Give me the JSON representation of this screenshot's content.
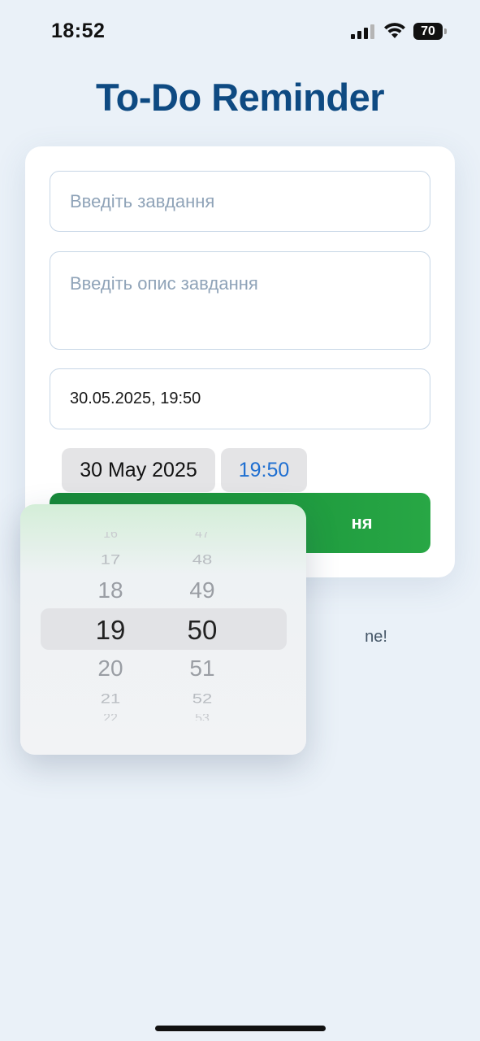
{
  "status_bar": {
    "time": "18:52",
    "battery": "70",
    "icons": [
      "signal-icon",
      "wifi-icon",
      "battery-icon"
    ]
  },
  "title": "To-Do Reminder",
  "form": {
    "task_placeholder": "Введіть завдання",
    "description_placeholder": "Введіть опис завдання",
    "datetime_value": "30.05.2025, 19:50",
    "date_chip": "30 May 2025",
    "time_chip": "19:50",
    "submit_label_visible": "ня"
  },
  "empty_text_visible": "ne!",
  "picker": {
    "hours": [
      "16",
      "17",
      "18",
      "19",
      "20",
      "21",
      "22"
    ],
    "minutes": [
      "47",
      "48",
      "49",
      "50",
      "51",
      "52",
      "53"
    ],
    "selected_hour": "19",
    "selected_minute": "50"
  },
  "colors": {
    "title": "#0e4a82",
    "accent_blue": "#1f6fd1",
    "button_green": "#1e9a3e",
    "background": "#eaf1f8"
  }
}
